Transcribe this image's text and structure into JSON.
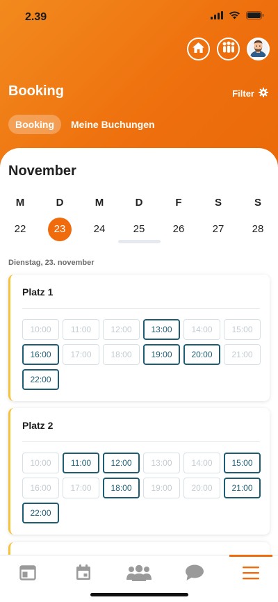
{
  "status": {
    "time": "2.39"
  },
  "header": {
    "title": "Booking",
    "filter_label": "Filter",
    "tabs": [
      {
        "label": "Booking",
        "active": true
      },
      {
        "label": "Meine Buchungen",
        "active": false
      }
    ]
  },
  "calendar": {
    "month": "November",
    "days": [
      {
        "letter": "M",
        "num": "22",
        "selected": false
      },
      {
        "letter": "D",
        "num": "23",
        "selected": true
      },
      {
        "letter": "M",
        "num": "24",
        "selected": false
      },
      {
        "letter": "D",
        "num": "25",
        "selected": false
      },
      {
        "letter": "F",
        "num": "26",
        "selected": false
      },
      {
        "letter": "S",
        "num": "27",
        "selected": false
      },
      {
        "letter": "S",
        "num": "28",
        "selected": false
      }
    ],
    "date_label": "Dienstag, 23. november"
  },
  "courts": [
    {
      "name": "Platz 1",
      "slots": [
        {
          "time": "10:00",
          "available": false
        },
        {
          "time": "11:00",
          "available": false
        },
        {
          "time": "12:00",
          "available": false
        },
        {
          "time": "13:00",
          "available": true
        },
        {
          "time": "14:00",
          "available": false
        },
        {
          "time": "15:00",
          "available": false
        },
        {
          "time": "16:00",
          "available": true
        },
        {
          "time": "17:00",
          "available": false
        },
        {
          "time": "18:00",
          "available": false
        },
        {
          "time": "19:00",
          "available": true
        },
        {
          "time": "20:00",
          "available": true
        },
        {
          "time": "21:00",
          "available": false
        },
        {
          "time": "22:00",
          "available": true
        }
      ]
    },
    {
      "name": "Platz 2",
      "slots": [
        {
          "time": "10:00",
          "available": false
        },
        {
          "time": "11:00",
          "available": true
        },
        {
          "time": "12:00",
          "available": true
        },
        {
          "time": "13:00",
          "available": false
        },
        {
          "time": "14:00",
          "available": false
        },
        {
          "time": "15:00",
          "available": true
        },
        {
          "time": "16:00",
          "available": false
        },
        {
          "time": "17:00",
          "available": false
        },
        {
          "time": "18:00",
          "available": true
        },
        {
          "time": "19:00",
          "available": false
        },
        {
          "time": "20:00",
          "available": false
        },
        {
          "time": "21:00",
          "available": true
        },
        {
          "time": "22:00",
          "available": true
        }
      ]
    }
  ],
  "bottom_nav": [
    {
      "icon": "dashboard-icon",
      "active": false
    },
    {
      "icon": "calendar-icon",
      "active": false
    },
    {
      "icon": "group-icon",
      "active": false
    },
    {
      "icon": "chat-icon",
      "active": false
    },
    {
      "icon": "menu-icon",
      "active": true
    }
  ],
  "colors": {
    "brand_orange": "#ef6b0b",
    "slot_available": "#1d5d74",
    "slot_unavailable": "#c2ccd1",
    "card_accent": "#f5c33b"
  }
}
